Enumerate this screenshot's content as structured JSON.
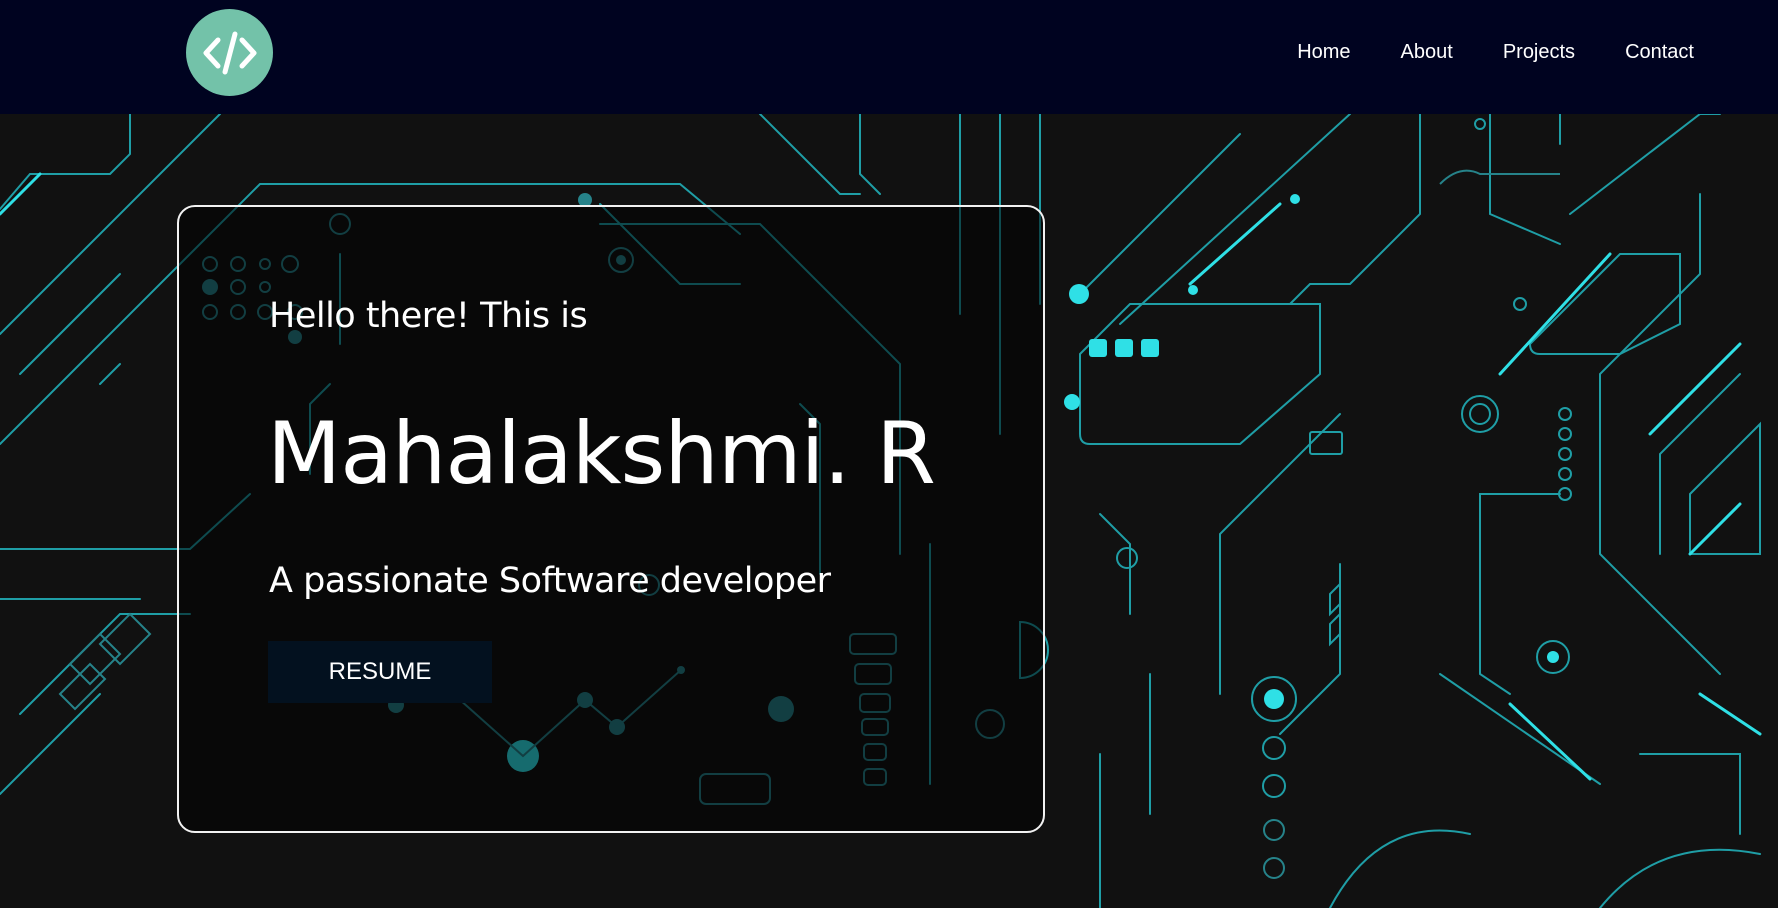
{
  "nav": {
    "logo_icon": "code-icon",
    "links": [
      "Home",
      "About",
      "Projects",
      "Contact"
    ]
  },
  "hero": {
    "greeting": "Hello there! This is",
    "name": "Mahalakshmi. R",
    "tagline": "A passionate Software developer",
    "resume_label": "RESUME"
  },
  "colors": {
    "navbar": "#000320",
    "logo": "#73c2a9",
    "background": "#111111",
    "circuit_accent": "#2fe0e6",
    "button": "#03111f"
  }
}
